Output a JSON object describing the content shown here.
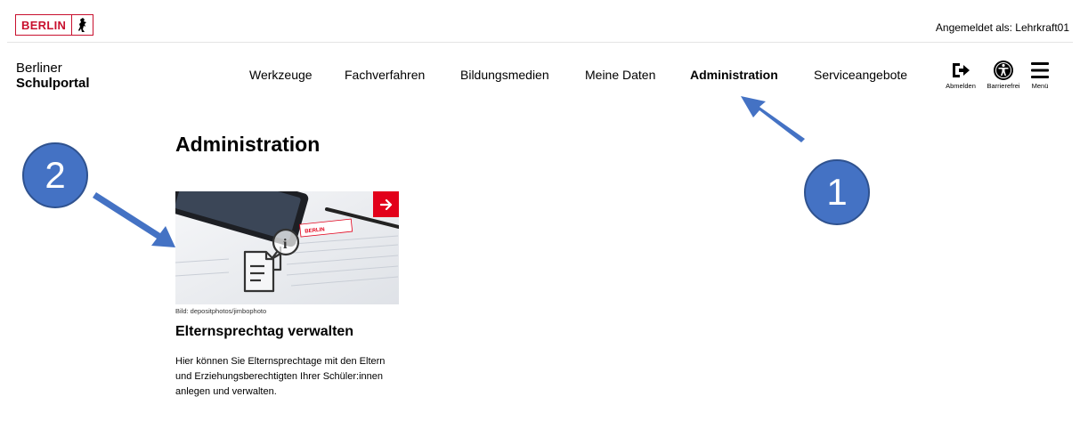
{
  "topbar": {
    "logo_text": "BERLIN",
    "user_info": "Angemeldet als: Lehrkraft01"
  },
  "brand": {
    "line1": "Berliner",
    "line2": "Schulportal"
  },
  "nav": {
    "items": [
      "Werkzeuge",
      "Fachverfahren",
      "Bildungsmedien",
      "Meine Daten",
      "Administration",
      "Serviceangebote"
    ],
    "active": "Administration"
  },
  "actions": {
    "logout": "Abmelden",
    "accessibility": "Barrierefrei",
    "menu": "Menü"
  },
  "main": {
    "title": "Administration",
    "card": {
      "image_credit": "Bild: depositphotos/jimbophoto",
      "image_brand": "BERLIN",
      "title": "Elternsprechtag verwalten",
      "description": "Hier können Sie Elternsprechtage mit den Eltern und Erziehungsberechtigten Ihrer Schüler:innen anlegen und verwalten."
    }
  },
  "annotations": {
    "marker1": "1",
    "marker2": "2"
  },
  "colors": {
    "brand_red": "#e2001a",
    "annotation_blue": "#4472c4"
  }
}
